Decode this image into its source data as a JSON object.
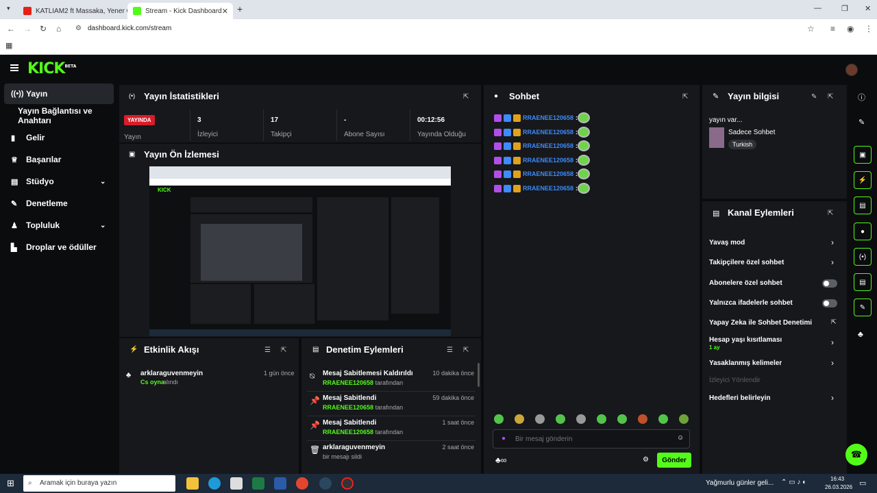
{
  "browser": {
    "tabs": [
      {
        "label": "KATLIAM2 ft Massaka, Yener Ce",
        "active": false
      },
      {
        "label": "Stream - Kick Dashboard",
        "active": true
      }
    ],
    "url": "dashboard.kick.com/stream"
  },
  "logo": {
    "text": "KICK",
    "badge": "BETA"
  },
  "sidebar": {
    "items": [
      {
        "label": "Yayın",
        "icon": "broadcast-icon"
      },
      {
        "label": "Yayın Bağlantısı ve Anahtarı",
        "icon": ""
      },
      {
        "label": "Gelir",
        "icon": "chart-icon"
      },
      {
        "label": "Başarılar",
        "icon": "trophy-icon"
      },
      {
        "label": "Stüdyo",
        "icon": "studio-icon"
      },
      {
        "label": "Denetleme",
        "icon": "wrench-icon"
      },
      {
        "label": "Topluluk",
        "icon": "community-icon"
      },
      {
        "label": "Droplar ve ödüller",
        "icon": "drops-icon"
      }
    ]
  },
  "stats": {
    "title": "Yayın İstatistikleri",
    "live_badge": "YAYINDA",
    "live_label": "Yayın",
    "cells": [
      {
        "value": "3",
        "label": "İzleyici"
      },
      {
        "value": "17",
        "label": "Takipçi"
      },
      {
        "value": "-",
        "label": "Abone Sayısı"
      },
      {
        "value": "00:12:56",
        "label": "Yayında Olduğu"
      }
    ]
  },
  "preview": {
    "title": "Yayın Ön İzlemesi"
  },
  "activity": {
    "title": "Etkinlik Akışı",
    "items": [
      {
        "user": "arklaraguvenmeyin",
        "action_strong": "Cs oyna",
        "action": "alındı",
        "time": "1 gün önce"
      }
    ]
  },
  "moderation": {
    "title": "Denetim Eylemleri",
    "items": [
      {
        "title": "Mesaj Sabitlemesi Kaldırıldı",
        "user": "RRAENEE120658",
        "suffix": "tarafından",
        "time": "10 dakika önce",
        "icon": "unpin-icon"
      },
      {
        "title": "Mesaj Sabitlendi",
        "user": "RRAENEE120658",
        "suffix": "tarafından",
        "time": "59 dakika önce",
        "icon": "pin-icon"
      },
      {
        "title": "Mesaj Sabitlendi",
        "user": "RRAENEE120658",
        "suffix": "tarafından",
        "time": "1 saat önce",
        "icon": "pin-icon"
      },
      {
        "title": "arklaraguvenmeyin",
        "user": "",
        "suffix": "bir mesajı sildi",
        "time": "2 saat önce",
        "icon": "trash-icon"
      }
    ]
  },
  "chat": {
    "title": "Sohbet",
    "messages": [
      {
        "user": "RRAENEE120658"
      },
      {
        "user": "RRAENEE120658"
      },
      {
        "user": "RRAENEE120658"
      },
      {
        "user": "RRAENEE120658"
      },
      {
        "user": "RRAENEE120658"
      },
      {
        "user": "RRAENEE120658"
      }
    ],
    "input_placeholder": "Bir mesaj gönderin",
    "send_label": "Gönder"
  },
  "stream_info": {
    "title": "Yayın bilgisi",
    "stream_title": "yayın var...",
    "category": "Sadece Sohbet",
    "tag": "Turkish"
  },
  "channel_actions": {
    "title": "Kanal Eylemleri",
    "items": [
      {
        "label": "Yavaş mod",
        "control": "chevron"
      },
      {
        "label": "Takipçilere özel sohbet",
        "control": "chevron"
      },
      {
        "label": "Abonelere özel sohbet",
        "control": "toggle",
        "on": false
      },
      {
        "label": "Yalnızca ifadelerle sohbet",
        "control": "toggle",
        "on": false
      },
      {
        "label": "Yapay Zeka ile Sohbet Denetimi",
        "control": "external"
      },
      {
        "label": "Hesap yaşı kısıtlaması",
        "sub": "1 ay",
        "control": "chevron"
      },
      {
        "label": "Yasaklanmış kelimeler",
        "control": "chevron"
      },
      {
        "label": "İzleyici Yönlendir",
        "control": "none",
        "disabled": true
      },
      {
        "label": "Hedefleri belirleyin",
        "control": "chevron"
      }
    ]
  },
  "taskbar": {
    "search_placeholder": "Aramak için buraya yazın",
    "weather": "Yağmurlu günler geli...",
    "time": "16:43",
    "date": "26.03.2026"
  },
  "colors": {
    "accent": "#53fc18",
    "live": "#d91c2a",
    "username": "#3d8bfd"
  }
}
